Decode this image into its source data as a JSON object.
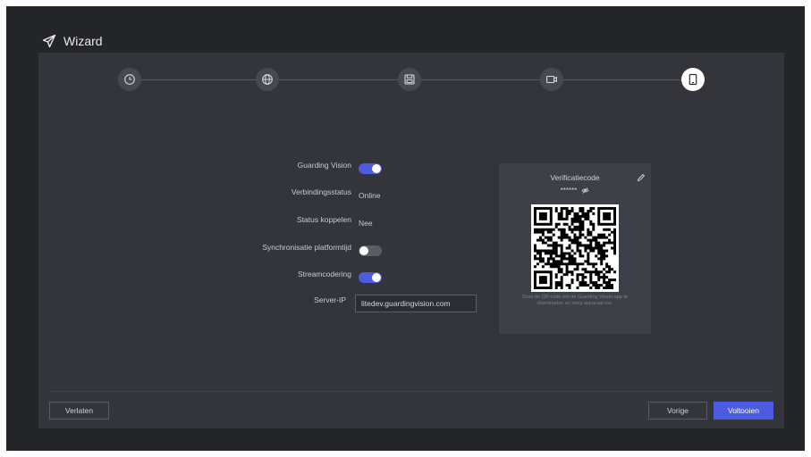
{
  "window": {
    "title": "Wizard"
  },
  "steps": [
    {
      "icon": "clock-icon",
      "active": false
    },
    {
      "icon": "globe-icon",
      "active": false
    },
    {
      "icon": "disk-icon",
      "active": false
    },
    {
      "icon": "camera-icon",
      "active": false
    },
    {
      "icon": "tablet-icon",
      "active": true
    }
  ],
  "form": {
    "guarding_vision_label": "Guarding Vision",
    "guarding_vision_on": true,
    "connection_label": "Verbindingsstatus",
    "connection_value": "Online",
    "link_label": "Status koppelen",
    "link_value": "Nee",
    "sync_label": "Synchronisatie platformtijd",
    "sync_on": false,
    "stream_label": "Streamcodering",
    "stream_on": true,
    "server_label": "Server-IP",
    "server_value": "litedev.guardingvision.com"
  },
  "verification": {
    "title": "Verificatiecode",
    "code": "******",
    "hint": "Scan de QR-code om de Guarding Vision-app te downloaden en voeg apparaat toe."
  },
  "footer": {
    "leave_label": "Verlaten",
    "prev_label": "Vorige",
    "finish_label": "Voltooien"
  },
  "colors": {
    "accent": "#4b5be2",
    "background": "#242529",
    "panel": "#33353b"
  }
}
